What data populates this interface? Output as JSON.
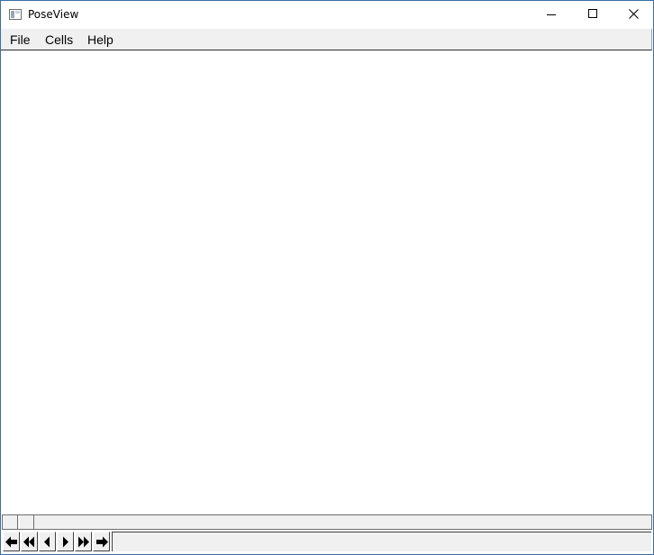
{
  "window": {
    "title": "PoseView"
  },
  "menu": {
    "items": [
      {
        "label": "File"
      },
      {
        "label": "Cells"
      },
      {
        "label": "Help"
      }
    ]
  },
  "navigation": {
    "buttons": [
      {
        "icon": "arrow-left-icon"
      },
      {
        "icon": "rewind-icon"
      },
      {
        "icon": "step-back-icon"
      },
      {
        "icon": "step-forward-icon"
      },
      {
        "icon": "fast-forward-icon"
      },
      {
        "icon": "arrow-right-icon"
      }
    ],
    "field_value": ""
  },
  "colors": {
    "chrome": "#f0f0f0",
    "canvas": "#ffffff",
    "window_border": "#3b6ea5"
  }
}
